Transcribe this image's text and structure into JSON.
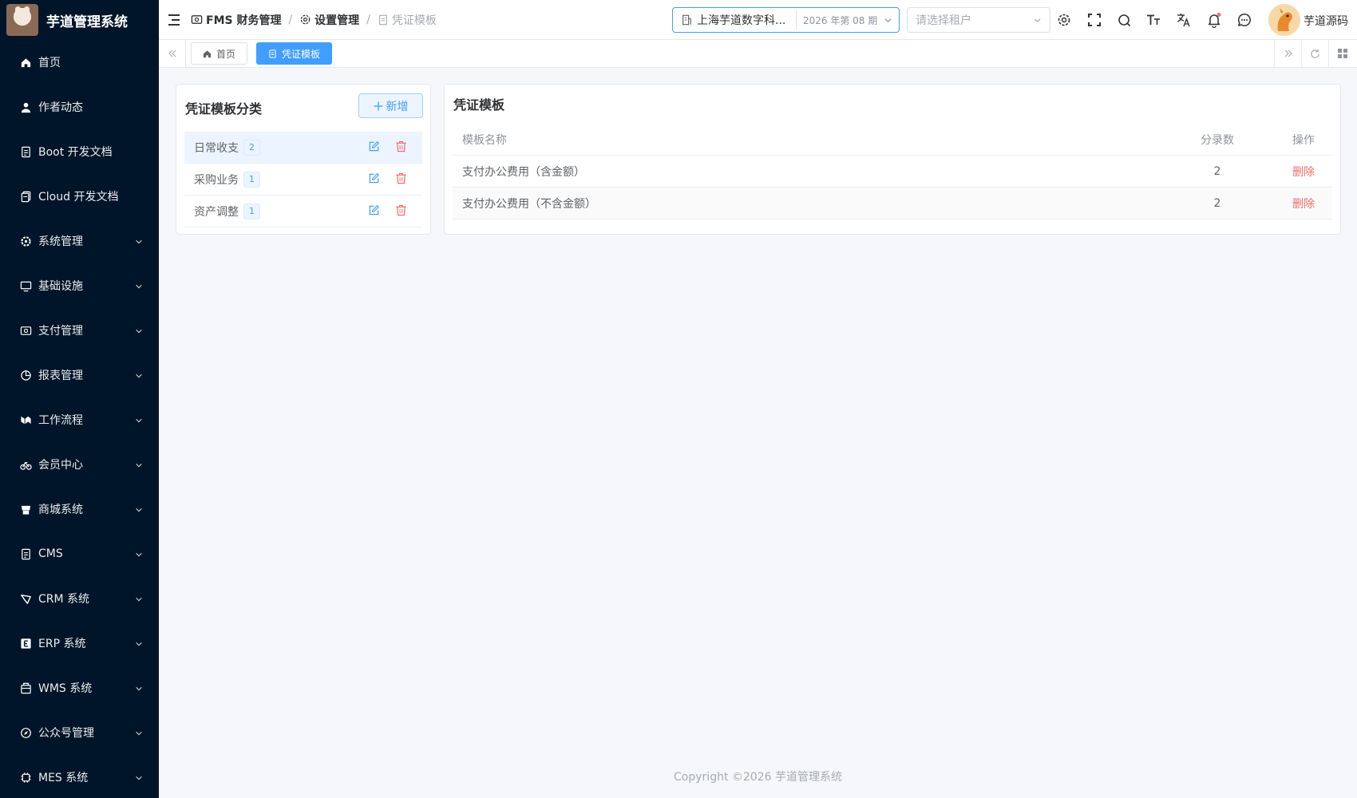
{
  "app": {
    "title": "芋道管理系统"
  },
  "sidebar": {
    "items": [
      {
        "label": "首页",
        "icon": "home-icon",
        "expandable": false
      },
      {
        "label": "作者动态",
        "icon": "user-icon",
        "expandable": false
      },
      {
        "label": "Boot 开发文档",
        "icon": "document-icon",
        "expandable": false
      },
      {
        "label": "Cloud 开发文档",
        "icon": "copy-document-icon",
        "expandable": false
      },
      {
        "label": "系统管理",
        "icon": "gear-icon",
        "expandable": true
      },
      {
        "label": "基础设施",
        "icon": "monitor-icon",
        "expandable": true
      },
      {
        "label": "支付管理",
        "icon": "payment-icon",
        "expandable": true
      },
      {
        "label": "报表管理",
        "icon": "pie-chart-icon",
        "expandable": true
      },
      {
        "label": "工作流程",
        "icon": "workflow-icon",
        "expandable": true
      },
      {
        "label": "会员中心",
        "icon": "bicycle-icon",
        "expandable": true
      },
      {
        "label": "商城系统",
        "icon": "shop-icon",
        "expandable": true
      },
      {
        "label": "CMS",
        "icon": "document-icon",
        "expandable": true
      },
      {
        "label": "CRM 系统",
        "icon": "crm-icon",
        "expandable": true
      },
      {
        "label": "ERP 系统",
        "icon": "erp-icon",
        "expandable": true
      },
      {
        "label": "WMS 系统",
        "icon": "warehouse-icon",
        "expandable": true
      },
      {
        "label": "公众号管理",
        "icon": "compass-icon",
        "expandable": true
      },
      {
        "label": "MES 系统",
        "icon": "cpu-icon",
        "expandable": true
      }
    ]
  },
  "header": {
    "breadcrumb": [
      {
        "label": "FMS 财务管理",
        "icon": "finance-icon"
      },
      {
        "label": "设置管理",
        "icon": "gear-icon"
      },
      {
        "label": "凭证模板",
        "icon": "template-icon"
      }
    ],
    "company": "上海芋道数字科...",
    "period": "2026 年第 08 期",
    "tenant_placeholder": "请选择租户",
    "username": "芋道源码"
  },
  "tags": [
    {
      "label": "首页",
      "icon": "home-icon",
      "active": false
    },
    {
      "label": "凭证模板",
      "icon": "template-icon",
      "active": true
    }
  ],
  "category_panel": {
    "title": "凭证模板分类",
    "add_label": "新增",
    "categories": [
      {
        "name": "日常收支",
        "count": "2",
        "selected": true
      },
      {
        "name": "采购业务",
        "count": "1",
        "selected": false
      },
      {
        "name": "资产调整",
        "count": "1",
        "selected": false
      }
    ]
  },
  "template_panel": {
    "title": "凭证模板",
    "columns": {
      "name": "模板名称",
      "entries": "分录数",
      "action": "操作"
    },
    "rows": [
      {
        "name": "支付办公费用（含金额）",
        "entries": "2",
        "action": "删除"
      },
      {
        "name": "支付办公费用（不含金额）",
        "entries": "2",
        "action": "删除"
      }
    ]
  },
  "footer": {
    "copyright": "Copyright ©2026 芋道管理系统"
  },
  "colors": {
    "primary": "#409eff",
    "danger": "#f56c6c",
    "sidebar_bg": "#001529",
    "notification_dot": "#f56c6c"
  }
}
